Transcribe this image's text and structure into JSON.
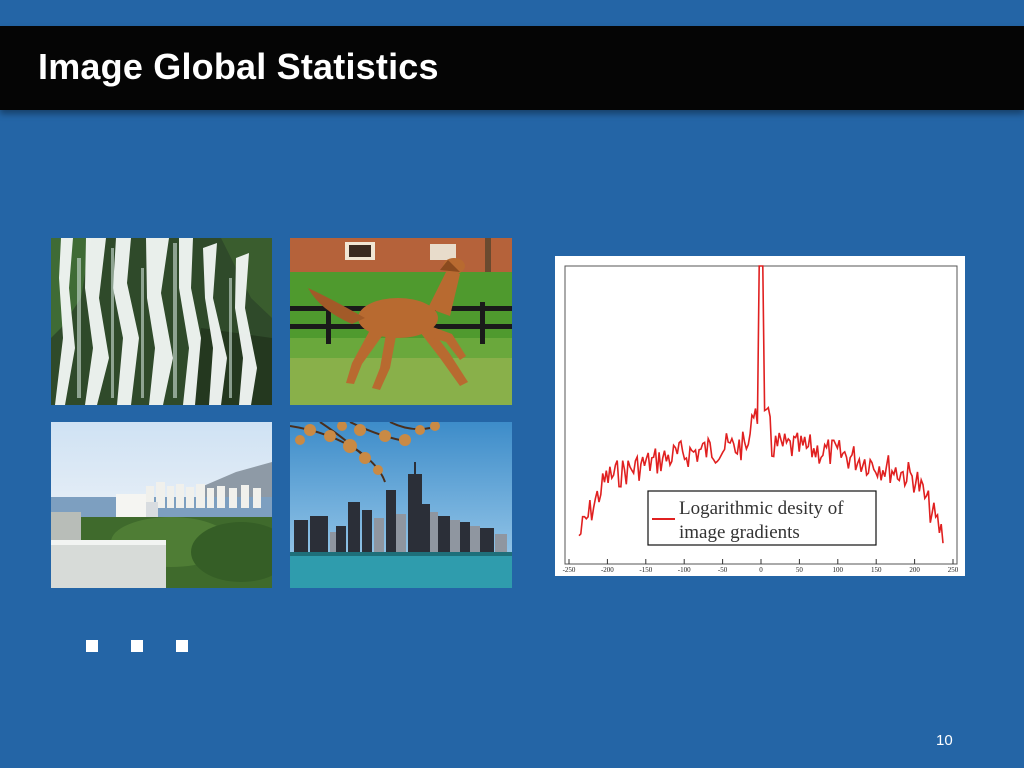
{
  "slide": {
    "title": "Image Global Statistics",
    "page_number": "10",
    "continuation_marks": [
      "■",
      "■",
      "■"
    ]
  },
  "photos": [
    {
      "subject": "waterfall"
    },
    {
      "subject": "horse"
    },
    {
      "subject": "coastal-city"
    },
    {
      "subject": "city-skyline"
    }
  ],
  "plot": {
    "legend_line1": "Logarithmic desity of",
    "legend_line2": "image gradients",
    "line_color": "#e02020",
    "x_ticks": [
      "-250",
      "-200",
      "-150",
      "-100",
      "-50",
      "0",
      "50",
      "100",
      "150",
      "200",
      "250"
    ]
  },
  "colors": {
    "background": "#2465a6",
    "title_bar": "#050505"
  }
}
